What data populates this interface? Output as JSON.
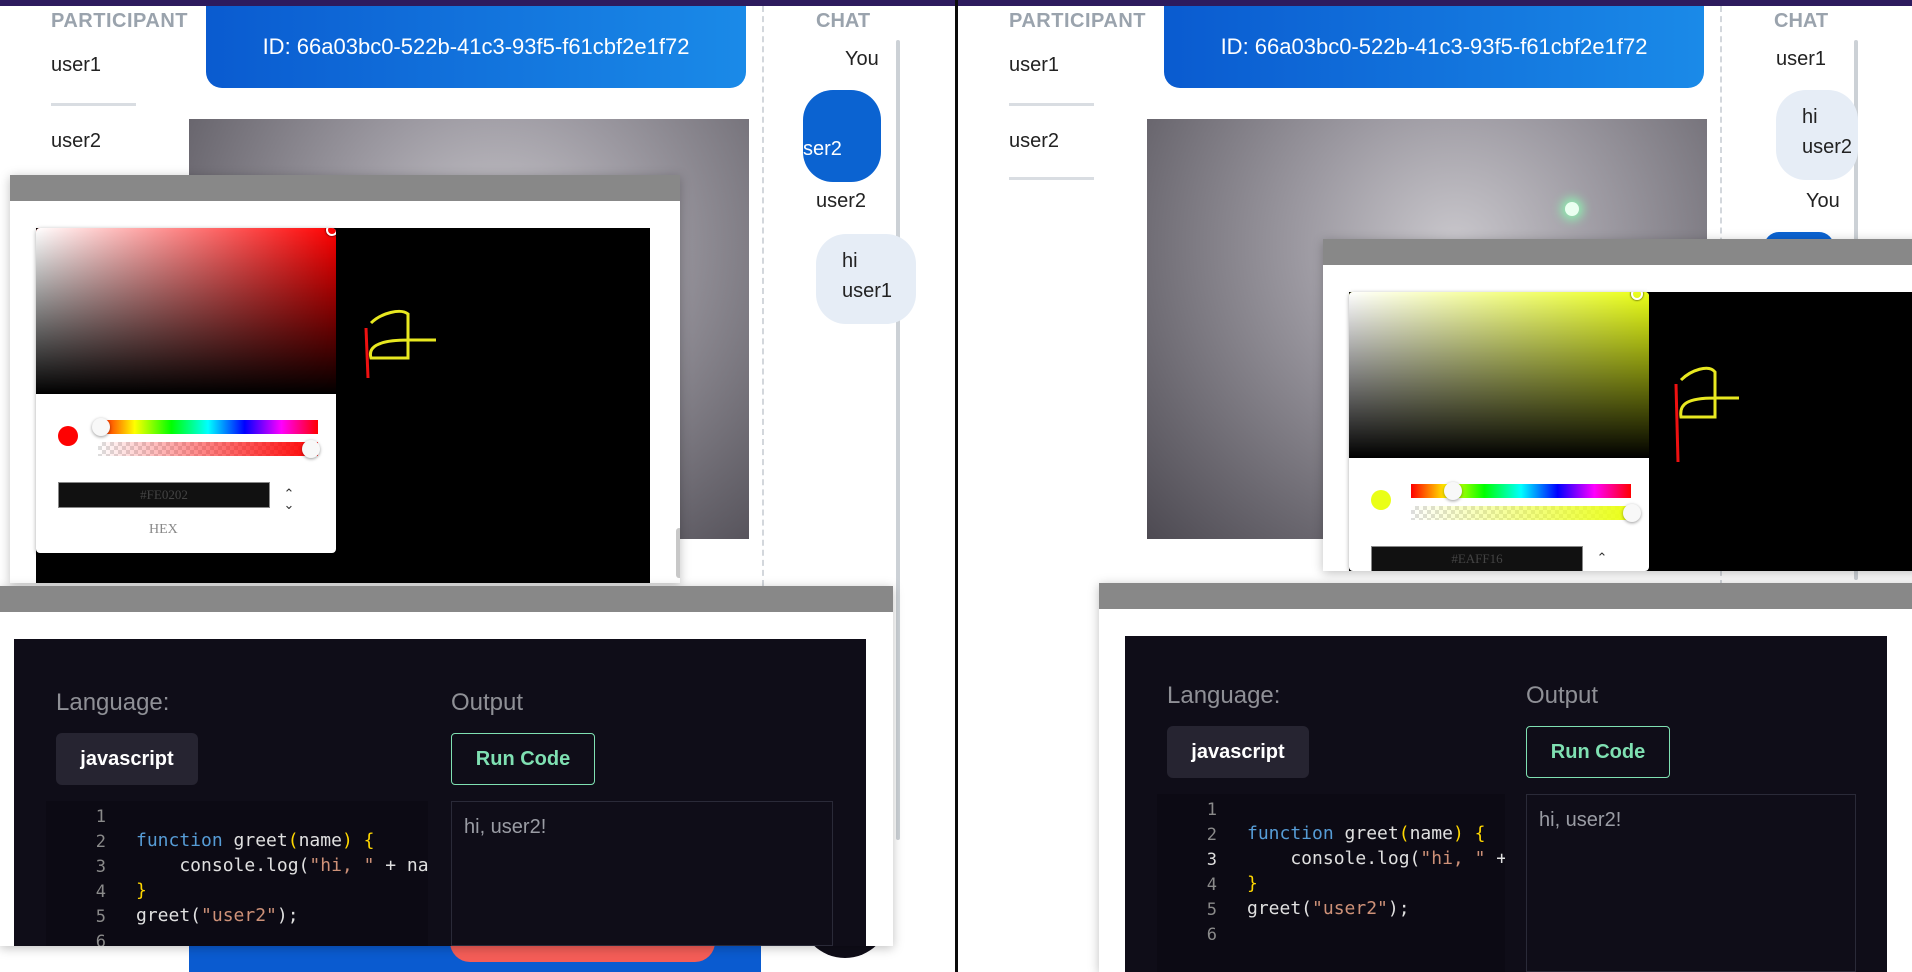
{
  "participants": {
    "heading": "PARTICIPANT",
    "users": [
      "user1",
      "user2"
    ]
  },
  "room": {
    "id_label": "ID: 66a03bc0-522b-41c3-93f5-f61cbf2e1f72"
  },
  "chat_left": {
    "heading": "CHAT",
    "name_you": "You",
    "bubble_you": "ser2",
    "name_user2": "user2",
    "bubble_user2_line1": "hi",
    "bubble_user2_line2": "user1"
  },
  "chat_right": {
    "heading": "CHAT",
    "name_user1": "user1",
    "bubble_user1_line1": "hi",
    "bubble_user1_line2": "user2",
    "name_you": "You"
  },
  "picker_left": {
    "hex": "#FE0202",
    "format_label": "HEX",
    "swatch_color": "#fe0202"
  },
  "picker_right": {
    "hex": "#EAFF16",
    "swatch_color": "#eaff16"
  },
  "editor": {
    "language_label": "Language:",
    "language_value": "javascript",
    "output_label": "Output",
    "run_label": "Run Code",
    "output_text": "hi, user2!",
    "line_numbers": [
      "1",
      "2",
      "3",
      "4",
      "5",
      "6"
    ]
  },
  "colors": {
    "accent_blue": "#0b63d1",
    "run_green": "#7fe0b2",
    "editor_bg": "#0f0d18",
    "end_red": "#f45d57"
  }
}
